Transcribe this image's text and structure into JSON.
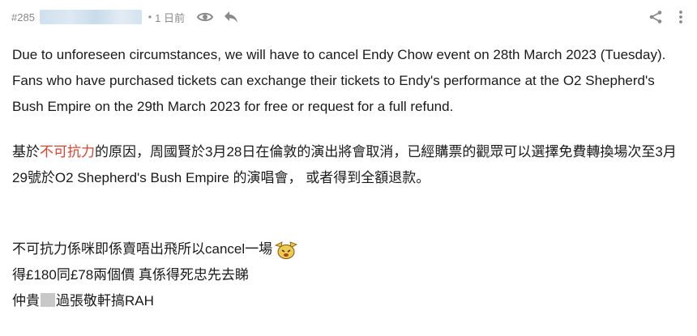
{
  "header": {
    "post_number": "#285",
    "dot": "•",
    "time": "1 日前",
    "icons": {
      "view": "eye-icon",
      "reply": "reply-arrow-icon",
      "share": "share-icon",
      "more": "more-vertical-icon"
    }
  },
  "content": {
    "english_paragraph": "Due to unforeseen circumstances, we will have to cancel Endy Chow event on 28th March 2023 (Tuesday). Fans who have purchased tickets can exchange their tickets to Endy's performance at the O2 Shepherd's Bush Empire on the 29th March 2023 for free or request for a full refund.",
    "chinese_prefix": "基於",
    "chinese_highlight": "不可抗力",
    "chinese_suffix": "的原因，周國賢於3月28日在倫敦的演出將會取消，已經購票的觀眾可以選擇免費轉換場次至3月29號於O2 Shepherd's Bush Empire 的演唱會， 或者得到全額退款。",
    "reply_line_1": "不可抗力係咪即係賣唔出飛所以cancel一場",
    "reply_line_2": "得£180同£78兩個價 真係得死忠先去睇",
    "reply_line_3_a": "仲貴",
    "reply_line_3_b": "過張敬軒搞RAH"
  },
  "colors": {
    "highlight": "#d9432e",
    "meta_text": "#8a8a8a",
    "icon": "#8a8a8a"
  }
}
